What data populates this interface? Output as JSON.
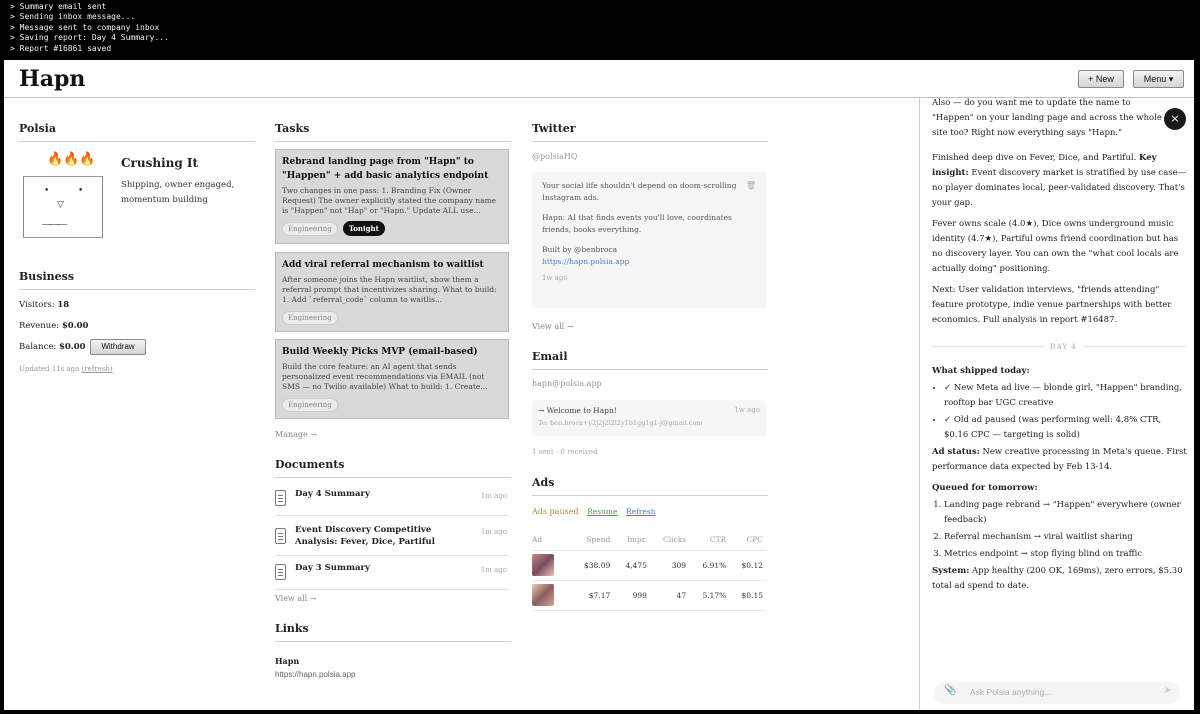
{
  "terminal": {
    "lines": [
      "> Summary email sent",
      "> Sending inbox message...",
      "> Message sent to company inbox",
      "> Saving report: Day 4 Summary...",
      "> Report #16861 saved"
    ]
  },
  "header": {
    "title": "Hapn",
    "new_label": "+ New",
    "menu_label": "Menu ▾"
  },
  "polsia": {
    "heading": "Polsia",
    "fire": "🔥🔥🔥",
    "status_title": "Crushing It",
    "status_desc": "Shipping, owner engaged, momentum building"
  },
  "business": {
    "heading": "Business",
    "visitors_label": "Visitors:",
    "visitors": "18",
    "revenue_label": "Revenue:",
    "revenue": "$0.00",
    "balance_label": "Balance:",
    "balance": "$0.00",
    "withdraw": "Withdraw",
    "updated": "Updated 11s ago",
    "refresh": "(refresh)"
  },
  "tasks": {
    "heading": "Tasks",
    "items": [
      {
        "title": "Rebrand landing page from \"Hapn\" to \"Happen\" + add basic analytics endpoint",
        "body": "Two changes in one pass: 1. Branding Fix (Owner Request) The owner explicitly stated the company name is \"Happen\" not \"Hap\" or \"Hapn.\" Update ALL use...",
        "tag": "Engineering",
        "tag2": "Tonight"
      },
      {
        "title": "Add viral referral mechanism to waitlist",
        "body": "After someone joins the Hapn waitlist, show them a referral prompt that incentivizes sharing. What to build: 1. Add `referral_code` column to waitlis...",
        "tag": "Engineering"
      },
      {
        "title": "Build Weekly Picks MVP (email-based)",
        "body": "Build the core feature: an AI agent that sends personalized event recommendations via EMAIL (not SMS — no Twilio available) What to build: 1. Create...",
        "tag": "Engineering"
      }
    ],
    "manage": "Manage →"
  },
  "documents": {
    "heading": "Documents",
    "items": [
      {
        "title": "Day 4 Summary",
        "time": "1m ago"
      },
      {
        "title": "Event Discovery Competitive Analysis: Fever, Dice, Partiful",
        "time": "1m ago"
      },
      {
        "title": "Day 3 Summary",
        "time": "1m ago"
      }
    ],
    "view_all": "View all →"
  },
  "links": {
    "heading": "Links",
    "name": "Hapn",
    "url": "https://hapn.polsia.app"
  },
  "twitter": {
    "heading": "Twitter",
    "handle": "@polsiaHQ",
    "tweet_p1": "Your social life shouldn't depend on doom-scrolling Instagram ads.",
    "tweet_p2": "Hapn: AI that finds events you'll love, coordinates friends, books everything.",
    "tweet_p3": "Built by @benbroca",
    "tweet_link": "https://hapn.polsia.app",
    "tweet_time": "1w ago",
    "view_all": "View all →"
  },
  "email": {
    "heading": "Email",
    "address": "hapn@polsia.app",
    "subject": "→ Welcome to Hapn!",
    "time": "1w ago",
    "to": "To: ben.broca+y2j2j2l2l2y1b1gg1g1-j@gmail.com",
    "stats": "1 sent · 0 received"
  },
  "ads": {
    "heading": "Ads",
    "status": "Ads paused",
    "resume": "Resume",
    "refresh": "Refresh",
    "columns": [
      "Ad",
      "Spend",
      "Impr.",
      "Clicks",
      "CTR",
      "CPC"
    ],
    "rows": [
      {
        "spend": "$38.09",
        "impr": "4,475",
        "clicks": "309",
        "ctr": "6.91%",
        "cpc": "$0.12"
      },
      {
        "spend": "$7.17",
        "impr": "999",
        "clicks": "47",
        "ctr": "5.17%",
        "cpc": "$0.15"
      }
    ]
  },
  "chat": {
    "p0": "Also — do you want me to update the name to \"Happen\" on your landing page and across the whole site too? Right now everything says \"Hapn.\"",
    "p1a": "Finished deep dive on Fever, Dice, and Partiful.",
    "p1b": "Key insight:",
    "p1c": "Event discovery market is stratified by use case—no player dominates local, peer-validated discovery. That's your gap.",
    "p2": "Fever owns scale (4.0★), Dice owns underground music identity (4.7★), Partiful owns friend coordination but has no discovery layer. You can own the \"what cool locals are actually doing\" positioning.",
    "p3": "Next: User validation interviews, \"friends attending\" feature prototype, indie venue partnerships with better economics. Full analysis in report #16487.",
    "day": "DAY 4",
    "shipped_h": "What shipped today:",
    "shipped": [
      "✓ New Meta ad live — blonde girl, \"Happen\" branding, rooftop bar UGC creative",
      "✓ Old ad paused (was performing well: 4.8% CTR, $0.16 CPC — targeting is solid)"
    ],
    "adstatus_h": "Ad status:",
    "adstatus": "New creative processing in Meta's queue. First performance data expected by Feb 13-14.",
    "queued_h": "Queued for tomorrow:",
    "queued": [
      "Landing page rebrand → \"Happen\" everywhere (owner feedback)",
      "Referral mechanism → viral waitlist sharing",
      "Metrics endpoint → stop flying blind on traffic"
    ],
    "system_h": "System:",
    "system": "App healthy (200 OK, 169ms), zero errors, $5.30 total ad spend to date.",
    "input_placeholder": "Ask Polsia anything...",
    "close": "×"
  }
}
